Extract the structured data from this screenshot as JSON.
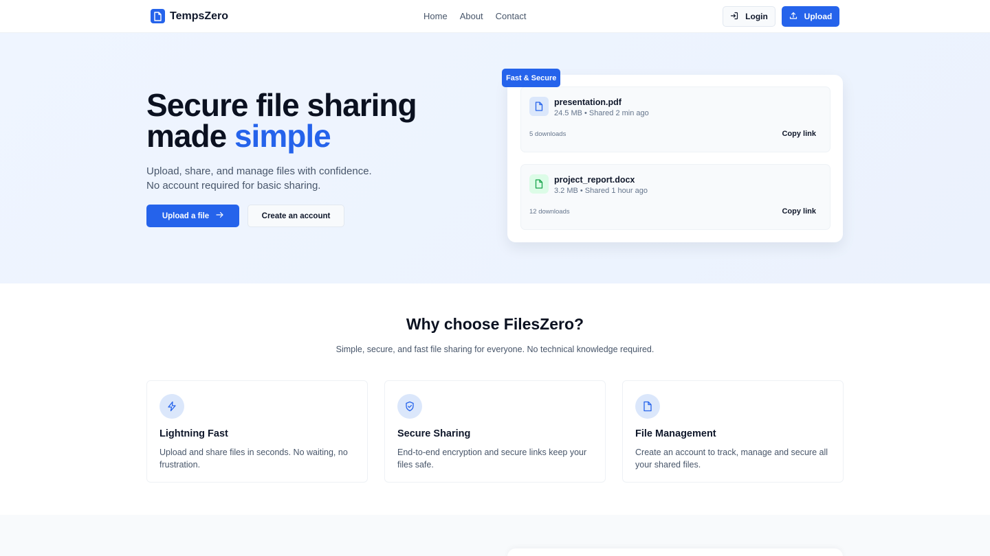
{
  "header": {
    "brand": "TempsZero",
    "nav": [
      "Home",
      "About",
      "Contact"
    ],
    "login_label": "Login",
    "upload_label": "Upload"
  },
  "hero": {
    "title_line1": "Secure file sharing",
    "title_line2_prefix": "made ",
    "title_line2_accent": "simple",
    "subtitle_line1": "Upload, share, and manage files with confidence.",
    "subtitle_line2": "No account required for basic sharing.",
    "primary_cta": "Upload a file",
    "secondary_cta": "Create an account",
    "badge": "Fast & Secure",
    "files": [
      {
        "name": "presentation.pdf",
        "meta": "24.5 MB • Shared 2 min ago",
        "downloads": "5 downloads",
        "action": "Copy link",
        "icon": "document-icon",
        "icon_color": "#2563eb"
      },
      {
        "name": "project_report.docx",
        "meta": "3.2 MB • Shared 1 hour ago",
        "downloads": "12 downloads",
        "action": "Copy link",
        "icon": "document-icon",
        "icon_color": "#16a34a"
      }
    ]
  },
  "features": {
    "title": "Why choose FilesZero?",
    "subtitle": "Simple, secure, and fast file sharing for everyone. No technical knowledge required.",
    "items": [
      {
        "title": "Lightning Fast",
        "desc": "Upload and share files in seconds. No waiting, no frustration.",
        "icon": "lightning-icon"
      },
      {
        "title": "Secure Sharing",
        "desc": "End-to-end encryption and secure links keep your files safe.",
        "icon": "shield-icon"
      },
      {
        "title": "File Management",
        "desc": "Create an account to track, manage and secure all your shared files.",
        "icon": "document-icon"
      }
    ]
  },
  "colors": {
    "accent": "#2563eb",
    "hero_bg": "#eff5ff",
    "text_dark": "#0f172a",
    "text_muted": "#475569"
  }
}
